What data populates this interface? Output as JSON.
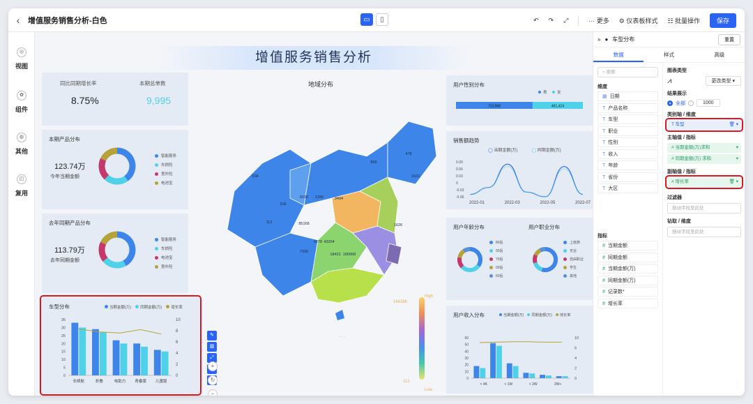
{
  "topbar": {
    "title": "增值服务销售分析-白色",
    "more": "··· 更多",
    "style": "仪表板样式",
    "batch": "批量操作",
    "save": "保存"
  },
  "nav": [
    "视图",
    "组件",
    "其他",
    "复用"
  ],
  "dashboard_title": "增值服务销售分析",
  "kpi": {
    "yoy_label": "同比同期增长率",
    "yoy_value": "8.75%",
    "orders_label": "本期总单数",
    "orders_value": "9,995"
  },
  "this_year": {
    "title": "本期产品分布",
    "amount": "123.74万",
    "amount_label": "今年当期金额",
    "legend": [
      "智能服务",
      "车损险",
      "意外险",
      "电池宝"
    ]
  },
  "last_year": {
    "title": "去年同期产品分布",
    "amount": "113.79万",
    "amount_label": "去年同期金额",
    "legend": [
      "智能服务",
      "车损险",
      "电池宝",
      "意外险"
    ]
  },
  "map": {
    "title": "地域分布",
    "high": "High",
    "low": "Low",
    "high_value": "164266",
    "low_value": "112",
    "labels": [
      "478",
      "868",
      "1622",
      "508",
      "5036",
      "1396",
      "318",
      "3404",
      "112",
      "85168",
      "4278",
      "7330",
      "43204",
      "18422",
      "180068",
      "1626"
    ]
  },
  "gender": {
    "title": "用户性别分布",
    "legend": [
      "男",
      "女"
    ],
    "values": [
      "733,988",
      "481,424"
    ]
  },
  "trend": {
    "title": "销售额趋势",
    "legend": [
      "当期金额(万)",
      "同期金额(万)"
    ]
  },
  "age": {
    "title": "用户年龄分布",
    "legend": [
      "80后",
      "90后",
      "70后",
      "00后",
      "60后"
    ]
  },
  "job": {
    "title": "用户职业分布",
    "legend": [
      "上班族",
      "无业",
      "自由职业",
      "学生",
      "其他"
    ]
  },
  "income": {
    "title": "用户收入分布",
    "legend": [
      "当期金额(万)",
      "同期金额(万)",
      "增长率"
    ]
  },
  "cartype": {
    "title": "车型分布",
    "legend": [
      "当期金额(万)",
      "同期金额(万)",
      "增长率"
    ]
  },
  "chart_data": [
    {
      "type": "bar",
      "title": "车型分布",
      "categories": [
        "长续航",
        "折叠",
        "电助力",
        "青春版",
        "儿童版"
      ],
      "series": [
        {
          "name": "当期金额(万)",
          "values": [
            33,
            29,
            22,
            20,
            16
          ]
        },
        {
          "name": "同期金额(万)",
          "values": [
            30,
            27,
            20,
            18,
            15
          ]
        },
        {
          "name": "增长率",
          "values": [
            8.3,
            7.8,
            7.6,
            8.2,
            7.4
          ],
          "axis": "right"
        }
      ],
      "ylim": [
        0,
        35
      ],
      "y2lim": [
        0,
        10
      ],
      "yticks": [
        "35",
        "30",
        "25",
        "20",
        "15",
        "10",
        "5",
        "0"
      ],
      "y2ticks": [
        "10",
        "8",
        "6",
        "4",
        "2",
        "0"
      ]
    },
    {
      "type": "bar",
      "title": "用户收入分布",
      "categories": [
        "< 4K",
        "< 1W",
        "< 2W",
        "2W+"
      ],
      "series": [
        {
          "name": "当期金额(万)",
          "values": [
            18,
            52,
            22,
            8,
            5,
            3
          ]
        },
        {
          "name": "同期金额(万)",
          "values": [
            15,
            48,
            18,
            7,
            4,
            3
          ]
        },
        {
          "name": "增长率",
          "values": [
            8.8,
            8.9,
            9.0,
            9.0,
            8.9,
            8.9
          ],
          "axis": "right"
        }
      ],
      "ylim": [
        0,
        60
      ],
      "y2lim": [
        0,
        10
      ],
      "yticks": [
        "60",
        "50",
        "40",
        "30",
        "20",
        "10",
        "0"
      ],
      "y2ticks": [
        "10",
        "6",
        "4",
        "2",
        "0"
      ]
    },
    {
      "type": "line",
      "title": "销售额趋势",
      "x": [
        "2022-01",
        "2022-03",
        "2022-05",
        "2022-07"
      ],
      "yticks": [
        "0.09",
        "0.06",
        "0.03",
        "0",
        "-0.03",
        "-0.06"
      ],
      "series": [
        {
          "name": "当期金额(万)",
          "values": [
            -0.05,
            -0.02,
            0.08,
            -0.04,
            -0.06,
            0.07,
            -0.05
          ]
        },
        {
          "name": "同期金额(万)",
          "values": [
            -0.05,
            -0.02,
            0.07,
            -0.04,
            -0.06,
            0.06,
            -0.05
          ]
        }
      ]
    },
    {
      "type": "pie",
      "title": "本期产品分布",
      "labels": [
        "智能服务",
        "车损险",
        "意外险",
        "电池宝"
      ],
      "values": [
        40,
        22,
        20,
        18
      ]
    },
    {
      "type": "pie",
      "title": "去年同期产品分布",
      "labels": [
        "智能服务",
        "车损险",
        "电池宝",
        "意外险"
      ],
      "values": [
        42,
        22,
        18,
        18
      ]
    },
    {
      "type": "pie",
      "title": "用户年龄分布",
      "labels": [
        "80后",
        "90后",
        "70后",
        "00后",
        "60后"
      ],
      "values": [
        35,
        28,
        15,
        12,
        10
      ]
    },
    {
      "type": "pie",
      "title": "用户职业分布",
      "labels": [
        "上班族",
        "无业",
        "自由职业",
        "学生",
        "其他"
      ],
      "values": [
        55,
        15,
        12,
        10,
        8
      ]
    },
    {
      "type": "bar",
      "title": "用户性别分布",
      "categories": [
        "男",
        "女"
      ],
      "values": [
        733988,
        481424
      ]
    }
  ],
  "panel": {
    "chart_name": "车型分布",
    "reset": "重置",
    "tabs": [
      "数据",
      "样式",
      "高级"
    ],
    "search": "搜索",
    "dim_title": "维度",
    "dims": [
      "日期",
      "产品名称",
      "车型",
      "职业",
      "性别",
      "收入",
      "年龄",
      "省份",
      "大区"
    ],
    "mea_title": "指标",
    "measures": [
      "当期金额",
      "同期金额",
      "当期金额(万)",
      "同期金额(万)",
      "记录数*",
      "增长率"
    ],
    "chart_type": "图表类型",
    "change_type": "更改类型",
    "result": "结果展示",
    "all": "全部",
    "limit": "1000",
    "axis_label": "类别轴 / 维度",
    "axis_value": "车型",
    "main_label": "主轴值 / 指标",
    "main_values": [
      "当期金额(万)求和",
      "同期金额(万) 求和"
    ],
    "sub_label": "副轴值 / 指标",
    "sub_value": "增长率",
    "filter_label": "过滤器",
    "filter_placeholder": "拖动字段至此处",
    "drill_label": "钻取 / 维度",
    "drill_placeholder": "拖动字段至此处"
  },
  "colors": {
    "accent": "#2a64f5",
    "blue": "#3d85e8",
    "cyan": "#4fd1e9",
    "red": "#c5386b",
    "olive": "#b5a33a",
    "highlight": "#e0141e"
  }
}
